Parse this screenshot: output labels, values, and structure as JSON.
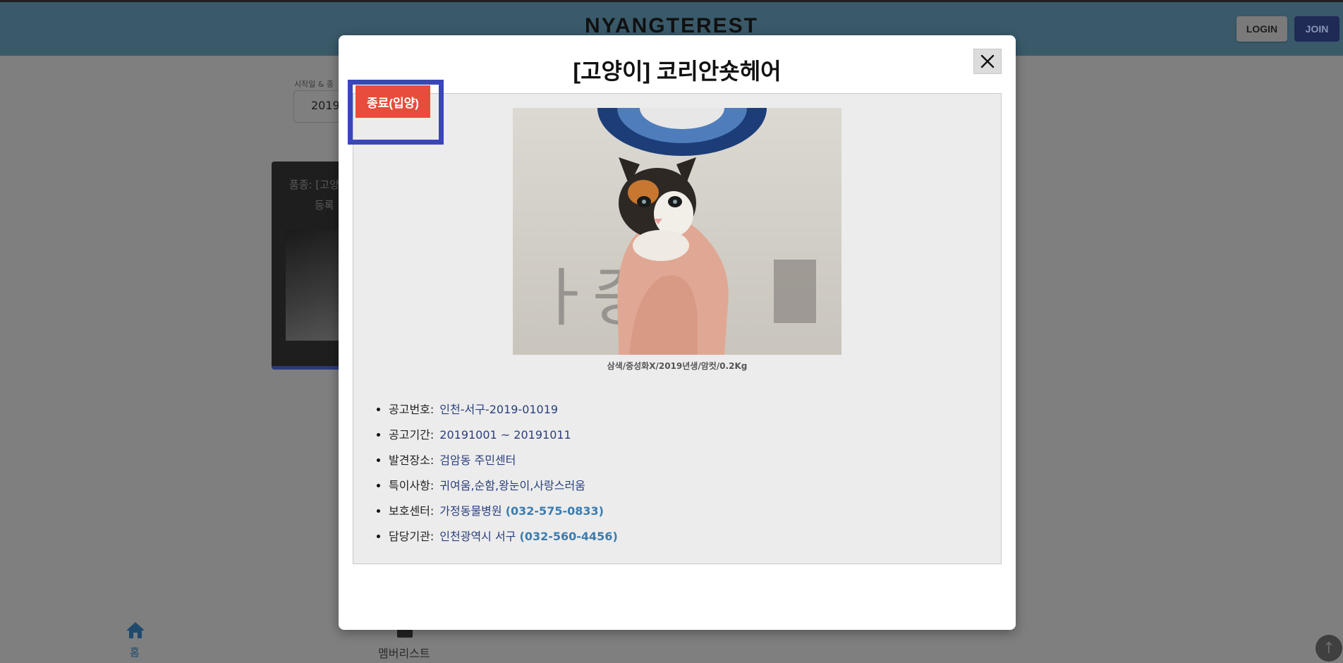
{
  "header": {
    "brand": "NYANGTEREST",
    "login_label": "LOGIN",
    "join_label": "JOIN"
  },
  "filter": {
    "label": "시작일 & 종",
    "value": "2019"
  },
  "background_card": {
    "line1": "품종: [고양",
    "line2": "등록"
  },
  "bottom_nav": {
    "home_label": "홈",
    "members_label": "멤버리스트"
  },
  "modal": {
    "title": "[고양이] 코리안숏헤어",
    "close_icon": "close-icon",
    "status": "종료(입양)",
    "caption": "삼색/중성화X/2019년생/암컷/0.2Kg",
    "info": [
      {
        "label": "공고번호:",
        "value": "인천-서구-2019-01019",
        "phone": ""
      },
      {
        "label": "공고기간:",
        "value": "20191001 ~ 20191011",
        "phone": ""
      },
      {
        "label": "발견장소:",
        "value": "검암동 주민센터",
        "phone": ""
      },
      {
        "label": "특이사항:",
        "value": "귀여움,순함,왕눈이,사랑스러움",
        "phone": ""
      },
      {
        "label": "보호센터:",
        "value": "가정동물병원",
        "phone": "(032-575-0833)"
      },
      {
        "label": "담당기관:",
        "value": "인천광역시 서구",
        "phone": "(032-560-4456)"
      }
    ]
  },
  "colors": {
    "status_badge": "#e74c3c",
    "highlight_border": "#3a46b8",
    "join_button": "#1f2a55"
  }
}
